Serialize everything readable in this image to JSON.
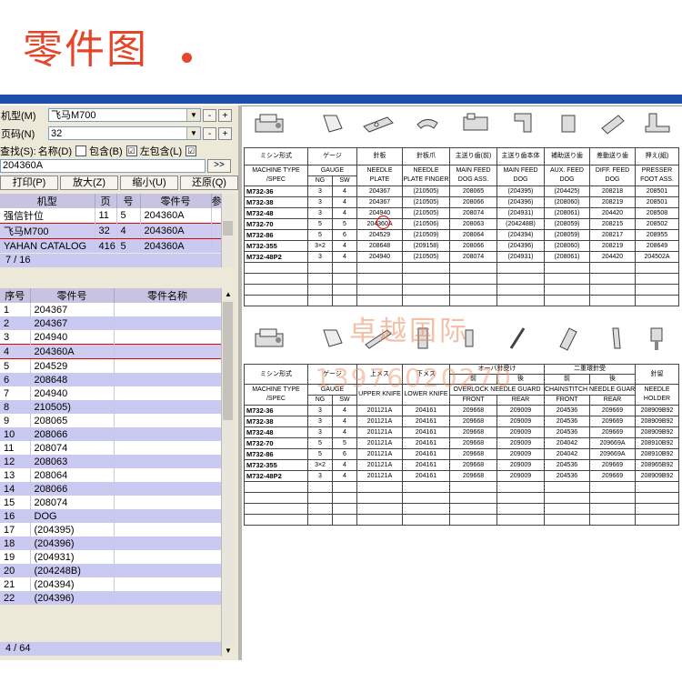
{
  "header": {
    "title": "零件图"
  },
  "controls": {
    "model_label": "机型(M)",
    "model_value": "飞马M700",
    "page_label": "页码(N)",
    "page_value": "32",
    "plus": "+",
    "minus": "-",
    "find_label": "查找(S):",
    "name_opt": "名称(D)",
    "contain_opt": "包含(B)",
    "left_contain_opt": "左包含(L)",
    "check_mark": "☑",
    "find_value": "204360A",
    "find_go": ">>",
    "print": "打印(P)",
    "zoom_in": "放大(Z)",
    "zoom_out": "缩小(U)",
    "restore": "还原(Q)"
  },
  "search_results": {
    "headers": [
      "机型",
      "页",
      "号",
      "零件号",
      "参"
    ],
    "rows": [
      [
        "强信针位",
        "11",
        "5",
        "204360A"
      ],
      [
        "飞马M700",
        "32",
        "4",
        "204360A"
      ],
      [
        "YAHAN CATALOG",
        "416",
        "5",
        "204360A"
      ]
    ],
    "pager": "7 / 16"
  },
  "parts_list": {
    "headers": [
      "序号",
      "零件号",
      "零件名称"
    ],
    "rows": [
      [
        "1",
        "204367"
      ],
      [
        "2",
        "204367"
      ],
      [
        "3",
        "204940"
      ],
      [
        "4",
        "204360A"
      ],
      [
        "5",
        "204529"
      ],
      [
        "6",
        "208648"
      ],
      [
        "7",
        "204940"
      ],
      [
        "8",
        "210505)"
      ],
      [
        "9",
        "208065"
      ],
      [
        "10",
        "208066"
      ],
      [
        "11",
        "208074"
      ],
      [
        "12",
        "208063"
      ],
      [
        "13",
        "208064"
      ],
      [
        "14",
        "208066"
      ],
      [
        "15",
        "208074"
      ],
      [
        "16",
        "DOG"
      ],
      [
        "17",
        "(204395)"
      ],
      [
        "18",
        "(204396)"
      ],
      [
        "19",
        "(204931)"
      ],
      [
        "20",
        "(204248B)"
      ],
      [
        "21",
        "(204394)"
      ],
      [
        "22",
        "(204396)"
      ]
    ],
    "pager": "4 / 64"
  },
  "doc_table1": {
    "header_jp": [
      "ミシン形式",
      "ゲージ",
      "針板",
      "針板爪",
      "主送り歯(前)",
      "主送り歯本体",
      "補助送り歯",
      "差動送り歯",
      "押え(組)"
    ],
    "header_en": [
      "MACHINE TYPE /SPEC",
      "GAUGE",
      "NEEDLE PLATE",
      "NEEDLE PLATE FINGER",
      "MAIN FEED DOG ASS.",
      "MAIN FEED DOG",
      "AUX. FEED DOG",
      "DIFF. FEED DOG",
      "PRESSER FOOT ASS."
    ],
    "gauge_sub": [
      "NG",
      "SW"
    ],
    "rows": [
      [
        "M732-36",
        "3",
        "4",
        "204367",
        "(210505)",
        "208065",
        "(204395)",
        "(204425)",
        "208218",
        "208501"
      ],
      [
        "M732-38",
        "3",
        "4",
        "204367",
        "(210505)",
        "208066",
        "(204396)",
        "(208060)",
        "208219",
        "208501"
      ],
      [
        "M732-48",
        "3",
        "4",
        "204940",
        "(210505)",
        "208074",
        "(204931)",
        "(208061)",
        "204420",
        "208508"
      ],
      [
        "M732-70",
        "5",
        "5",
        "204360A",
        "(210506)",
        "208063",
        "(204248B)",
        "(208059)",
        "208215",
        "208502"
      ],
      [
        "M732-86",
        "5",
        "6",
        "204529",
        "(210509)",
        "208064",
        "(204394)",
        "(208059)",
        "208217",
        "208955"
      ],
      [
        "M732-355",
        "3×2",
        "4",
        "208648",
        "(209158)",
        "208066",
        "(204396)",
        "(208060)",
        "208219",
        "208649"
      ],
      [
        "M732-48P2",
        "3",
        "4",
        "204940",
        "(210505)",
        "208074",
        "(204931)",
        "(208061)",
        "204420",
        "204502A"
      ]
    ]
  },
  "doc_table2": {
    "header_jp": [
      "ミシン形式",
      "ゲージ",
      "上メス",
      "下メス",
      "オーバ針受け",
      "二重環針受",
      "針留"
    ],
    "jp_sub": [
      "前",
      "後",
      "前",
      "後"
    ],
    "header_en": [
      "MACHINE TYPE /SPEC",
      "GAUGE",
      "UPPER KNIFE",
      "LOWER KNIFE",
      "OVERLOCK NEEDLE GUARD",
      "CHAINSTITCH NEEDLE GUARD",
      "NEEDLE HOLDER"
    ],
    "en_sub": [
      "NG",
      "SW",
      "FRONT",
      "REAR",
      "FRONT",
      "REAR"
    ],
    "rows": [
      [
        "M732-36",
        "3",
        "4",
        "201121A",
        "204161",
        "209668",
        "209009",
        "204536",
        "209669",
        "208909B92"
      ],
      [
        "M732-38",
        "3",
        "4",
        "201121A",
        "204161",
        "209668",
        "209009",
        "204536",
        "209669",
        "208909B92"
      ],
      [
        "M732-48",
        "3",
        "4",
        "201121A",
        "204161",
        "209668",
        "209009",
        "204536",
        "209669",
        "208909B92"
      ],
      [
        "M732-70",
        "5",
        "5",
        "201121A",
        "204161",
        "209668",
        "209009",
        "204042",
        "209669A",
        "208910B92"
      ],
      [
        "M732-86",
        "5",
        "6",
        "201121A",
        "204161",
        "209668",
        "209009",
        "204042",
        "209669A",
        "208910B92"
      ],
      [
        "M732-355",
        "3×2",
        "4",
        "201121A",
        "204161",
        "209668",
        "209009",
        "204536",
        "209669",
        "208965B92"
      ],
      [
        "M732-48P2",
        "3",
        "4",
        "201121A",
        "204161",
        "209668",
        "209009",
        "204536",
        "209669",
        "208909B92"
      ]
    ]
  },
  "watermark": {
    "text1": "卓越国际",
    "text2": "13976020270"
  },
  "colors": {
    "title_red": "#e3462a",
    "bar_blue": "#1d50a8",
    "row_blue": "#c9c9f2"
  }
}
